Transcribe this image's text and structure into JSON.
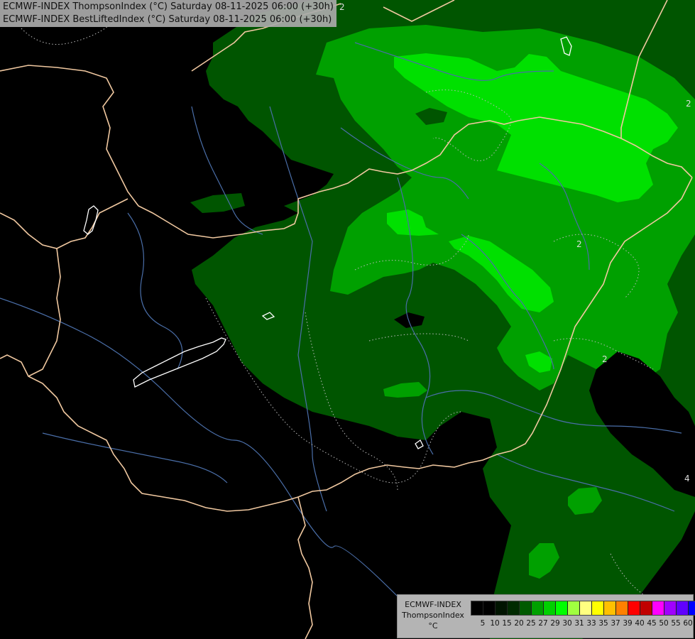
{
  "header": {
    "line1": "ECMWF-INDEX ThompsonIndex (°C) Saturday 08-11-2025 06:00 (+30h)",
    "line2": "ECMWF-INDEX BestLiftedIndex (°C) Saturday 08-11-2025 06:00 (+30h)"
  },
  "map": {
    "contour_labels": [
      "2",
      "2",
      "2",
      "2",
      "4"
    ],
    "colors": {
      "background": "#000000",
      "dark_green": "#004d00",
      "green": "#00a000",
      "mid_green": "#00c800",
      "bright_green": "#00f000",
      "border": "#f0c8a0",
      "river": "#4a6ea8",
      "lake_outline": "#ffffff"
    }
  },
  "legend": {
    "label_lines": [
      "ECMWF-INDEX",
      "ThompsonIndex",
      "°C"
    ],
    "ticks": [
      "5",
      "10",
      "15",
      "20",
      "25",
      "27",
      "29",
      "30",
      "31",
      "33",
      "35",
      "37",
      "39",
      "40",
      "45",
      "50",
      "55",
      "60"
    ],
    "swatches": [
      "#000000",
      "#000000",
      "#001400",
      "#002a00",
      "#005a00",
      "#00a000",
      "#00d000",
      "#00ff00",
      "#a0ff40",
      "#ffff80",
      "#ffff00",
      "#ffc000",
      "#ff8000",
      "#ff0000",
      "#c00000",
      "#ff00ff",
      "#a000ff",
      "#6000ff",
      "#0000ff"
    ]
  }
}
